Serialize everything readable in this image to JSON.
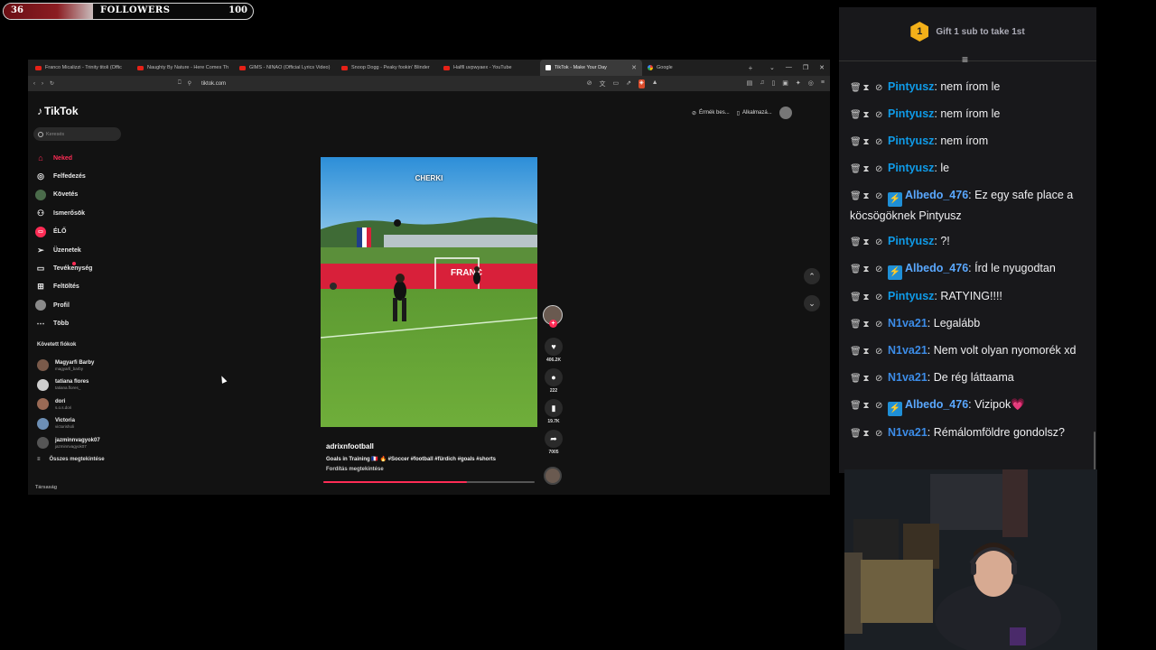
{
  "goal": {
    "current": "36",
    "label": "FOLLOWERS",
    "target": "100",
    "progress_fraction": 0.36,
    "fill_color": "#8b1d22"
  },
  "browser": {
    "tabs": [
      {
        "title": "Franco Micalizzi - Trinity titoli (Offic",
        "icon": "youtube-icon"
      },
      {
        "title": "Naughty By Nature - Here Comes Th",
        "icon": "youtube-icon"
      },
      {
        "title": "GIMS - NINAO (Official Lyrics Video)",
        "icon": "youtube-icon"
      },
      {
        "title": "Snoop Dogg - Peaky fookin' Blinder",
        "icon": "youtube-icon"
      },
      {
        "title": "Halfll uvpwyaex - YouTube",
        "icon": "youtube-icon"
      },
      {
        "title": "TikTok - Make Your Day",
        "icon": "tiktok-icon",
        "active": true
      },
      {
        "title": "Google",
        "icon": "google-icon"
      }
    ],
    "new_tab": "+",
    "url": "tiktok.com"
  },
  "tiktok": {
    "logo": "TikTok",
    "search_placeholder": "Keresés",
    "nav": [
      {
        "label": "Neked",
        "icon": "home-icon",
        "active": true
      },
      {
        "label": "Felfedezés",
        "icon": "compass-icon"
      },
      {
        "label": "Követés",
        "icon": "following-icon"
      },
      {
        "label": "Ismerősök",
        "icon": "friends-icon"
      },
      {
        "label": "ÉLŐ",
        "icon": "live-icon"
      },
      {
        "label": "Üzenetek",
        "icon": "messages-icon"
      },
      {
        "label": "Tevékenység",
        "icon": "activity-icon"
      },
      {
        "label": "Feltöltés",
        "icon": "upload-icon"
      },
      {
        "label": "Profil",
        "icon": "profile-icon"
      },
      {
        "label": "Több",
        "icon": "more-icon"
      }
    ],
    "followed_title": "Követett fiókok",
    "followed": [
      {
        "name": "Magyarfi Barby",
        "handle": "magyarfi_barby"
      },
      {
        "name": "tatiana flores",
        "handle": "tatiana.flores_"
      },
      {
        "name": "dori",
        "handle": "s.o.s.dori"
      },
      {
        "name": "Victoria",
        "handle": "victorisholi"
      },
      {
        "name": "jazminnvagyok07",
        "handle": "jazminnvagyok07"
      }
    ],
    "see_all": "Összes megtekintése",
    "company": "Társaság",
    "top_right": {
      "effects": "Érmék bes...",
      "app": "Alkalmazá..."
    },
    "video": {
      "overlay_text": "CHERKI",
      "username": "adrixnfootball",
      "description": "Goals in Training 🇫🇷 🔥 #Soccer #football #fürdich #goals #shorts",
      "translate": "Fordítás megtekintése",
      "likes": "406.2K",
      "comments": "222",
      "saves": "19.7K",
      "shares": "7005",
      "progress_fraction": 0.68
    }
  },
  "chat": {
    "gift_number": "1",
    "gift_text": "Gift 1 sub to take 1st",
    "messages": [
      {
        "user": "Pintyusz",
        "text": "nem írom le",
        "color": "#0f9be8"
      },
      {
        "user": "Pintyusz",
        "text": "nem írom le",
        "color": "#0f9be8"
      },
      {
        "user": "Pintyusz",
        "text": "nem írom",
        "color": "#0f9be8"
      },
      {
        "user": "Pintyusz",
        "text": "le",
        "color": "#0f9be8"
      },
      {
        "user": "Albedo_476",
        "text": "Ez egy safe place a köcsögöknek Pintyusz",
        "color": "#5aa8ff",
        "bolt": true
      },
      {
        "user": "Pintyusz",
        "text": "?!",
        "color": "#0f9be8"
      },
      {
        "user": "Albedo_476",
        "text": "Írd le nyugodtan",
        "color": "#5aa8ff",
        "bolt": true
      },
      {
        "user": "Pintyusz",
        "text": "RATYING!!!!",
        "color": "#0f9be8"
      },
      {
        "user": "N1va21",
        "text": "Legalább",
        "color": "#3c8ce7"
      },
      {
        "user": "N1va21",
        "text": "Nem volt olyan nyomorék xd",
        "color": "#3c8ce7"
      },
      {
        "user": "N1va21",
        "text": "De rég láttaama",
        "color": "#3c8ce7"
      },
      {
        "user": "Albedo_476",
        "text": "Vizipok",
        "color": "#5aa8ff",
        "bolt": true,
        "heart": "💗"
      },
      {
        "user": "N1va21",
        "text": "Rémálomföldre gondolsz?",
        "color": "#3c8ce7"
      }
    ]
  }
}
